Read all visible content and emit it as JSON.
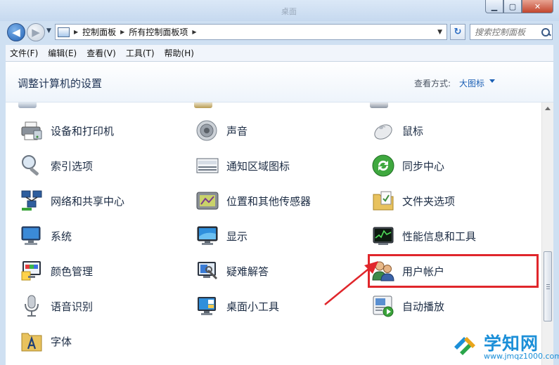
{
  "window": {
    "title": "桌面",
    "min_glyph": "▁",
    "max_glyph": "▢",
    "close_glyph": "✕"
  },
  "address": {
    "crumbs": [
      "控制面板",
      "所有控制面板项"
    ],
    "search_placeholder": "搜索控制面板"
  },
  "menu": [
    "文件(F)",
    "编辑(E)",
    "查看(V)",
    "工具(T)",
    "帮助(H)"
  ],
  "header": {
    "title": "调整计算机的设置",
    "view_label": "查看方式:",
    "view_value": "大图标"
  },
  "items": [
    {
      "label": "设备和打印机",
      "icon": "printer-icon"
    },
    {
      "label": "声音",
      "icon": "speaker-icon"
    },
    {
      "label": "鼠标",
      "icon": "mouse-icon"
    },
    {
      "label": "索引选项",
      "icon": "magnifier-icon"
    },
    {
      "label": "通知区域图标",
      "icon": "tray-icon"
    },
    {
      "label": "同步中心",
      "icon": "sync-icon"
    },
    {
      "label": "网络和共享中心",
      "icon": "network-icon"
    },
    {
      "label": "位置和其他传感器",
      "icon": "sensor-icon"
    },
    {
      "label": "文件夹选项",
      "icon": "folder-options-icon"
    },
    {
      "label": "系统",
      "icon": "computer-icon"
    },
    {
      "label": "显示",
      "icon": "display-icon"
    },
    {
      "label": "性能信息和工具",
      "icon": "performance-icon"
    },
    {
      "label": "颜色管理",
      "icon": "color-management-icon"
    },
    {
      "label": "疑难解答",
      "icon": "troubleshoot-icon"
    },
    {
      "label": "用户帐户",
      "icon": "user-accounts-icon"
    },
    {
      "label": "语音识别",
      "icon": "microphone-icon"
    },
    {
      "label": "桌面小工具",
      "icon": "gadgets-icon"
    },
    {
      "label": "自动播放",
      "icon": "autoplay-icon"
    },
    {
      "label": "字体",
      "icon": "fonts-icon"
    }
  ],
  "annotation": {
    "highlighted_item": "用户帐户",
    "color": "#e0262b"
  },
  "watermark": {
    "title": "学知网",
    "url": "www.jmqz1000.com"
  },
  "colors": {
    "link": "#1a5fb4",
    "title": "#1d3253",
    "watermark": "#1b8fd8"
  }
}
